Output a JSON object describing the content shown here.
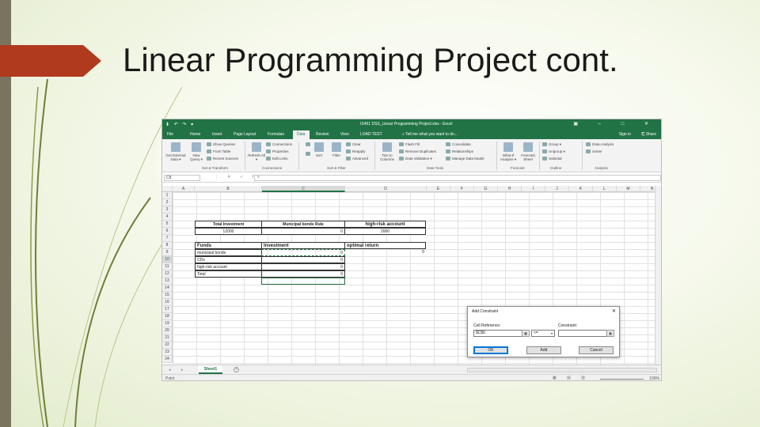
{
  "slide": {
    "title": "Linear Programming Project cont."
  },
  "excel": {
    "window_title": "IS461 DSS_Linear Programming Project.xlsx - Excel",
    "quick_access": "⬇ ↶ ↷ ▾",
    "window_controls": "▣ – □ ✕",
    "tabs": [
      "File",
      "Home",
      "Insert",
      "Page Layout",
      "Formulas",
      "Data",
      "Review",
      "View",
      "LOAD TEST"
    ],
    "active_tab": "Data",
    "tell_me": "⌕ Tell me what you want to do...",
    "sign_in": "Sign in",
    "share": "⎗ Share",
    "ribbon": {
      "get_external_data": "Get External Data ▾",
      "new_query": "New Query ▾",
      "show_queries": "Show Queries",
      "from_table": "From Table",
      "recent_sources": "Recent Sources",
      "refresh_all": "Refresh All ▾",
      "connections": "Connections",
      "properties": "Properties",
      "edit_links": "Edit Links",
      "sort": "Sort",
      "filter": "Filter",
      "clear": "Clear",
      "reapply": "Reapply",
      "advanced": "Advanced",
      "text_to_columns": "Text to Columns",
      "flash_fill": "Flash Fill",
      "remove_duplicates": "Remove Duplicates",
      "data_validation": "Data Validation ▾",
      "consolidate": "Consolidate",
      "relationships": "Relationships",
      "manage_data_model": "Manage Data Model",
      "what_if": "What-If Analysis ▾",
      "forecast_sheet": "Forecast Sheet",
      "group": "Group ▾",
      "ungroup": "Ungroup ▾",
      "subtotal": "Subtotal",
      "data_analysis": "Data Analysis",
      "solver": "Solver",
      "groups": [
        "Get & Transform",
        "Connections",
        "Sort & Filter",
        "Data Tools",
        "Forecast",
        "Outline",
        "Analysis"
      ]
    },
    "name_box": "C8",
    "fx_icons": "⋮ ✕ ✓ fx",
    "columns": [
      "A",
      "B",
      "C",
      "D",
      "E",
      "F",
      "G",
      "H",
      "I",
      "J",
      "K",
      "L",
      "M",
      "N"
    ],
    "rows": [
      "1",
      "2",
      "3",
      "4",
      "5",
      "6",
      "7",
      "8",
      "9",
      "10",
      "11",
      "12",
      "13",
      "14",
      "15",
      "16",
      "17",
      "18",
      "19",
      "20",
      "21",
      "22",
      "23",
      "24"
    ],
    "cells": {
      "total_investment_label": "Total Investment",
      "total_investment_value": "12000",
      "municipal_rule_label": "Municipal bonds Rule",
      "municipal_rule_value": "0",
      "high_risk_label": "high-risk account",
      "high_risk_value": "2000",
      "funds_header": "Funds",
      "investment_header": "Investment",
      "optimal_return_header": "optimal return",
      "fund_1": "municipal bonds",
      "fund_2": "CDs",
      "fund_3": "high-risk account",
      "total_label": "Total",
      "inv_1": "0",
      "inv_2": "0",
      "inv_3": "0",
      "inv_total": "0",
      "optimal_return_value": "0"
    },
    "dialog": {
      "title": "Add Constraint",
      "close": "✕",
      "cell_reference_label": "Cell Reference:",
      "cell_reference_value": "$C$6",
      "constraint_label": "Constraint:",
      "operator": "<=",
      "constraint_value": "",
      "ok": "OK",
      "add": "Add",
      "cancel": "Cancel"
    },
    "sheet_tab": "Sheet1",
    "add_sheet": "+",
    "sheet_nav": "◂ ▸",
    "status": "Point",
    "view_icons": "▦ ▤ ▥",
    "zoom": "100%"
  }
}
